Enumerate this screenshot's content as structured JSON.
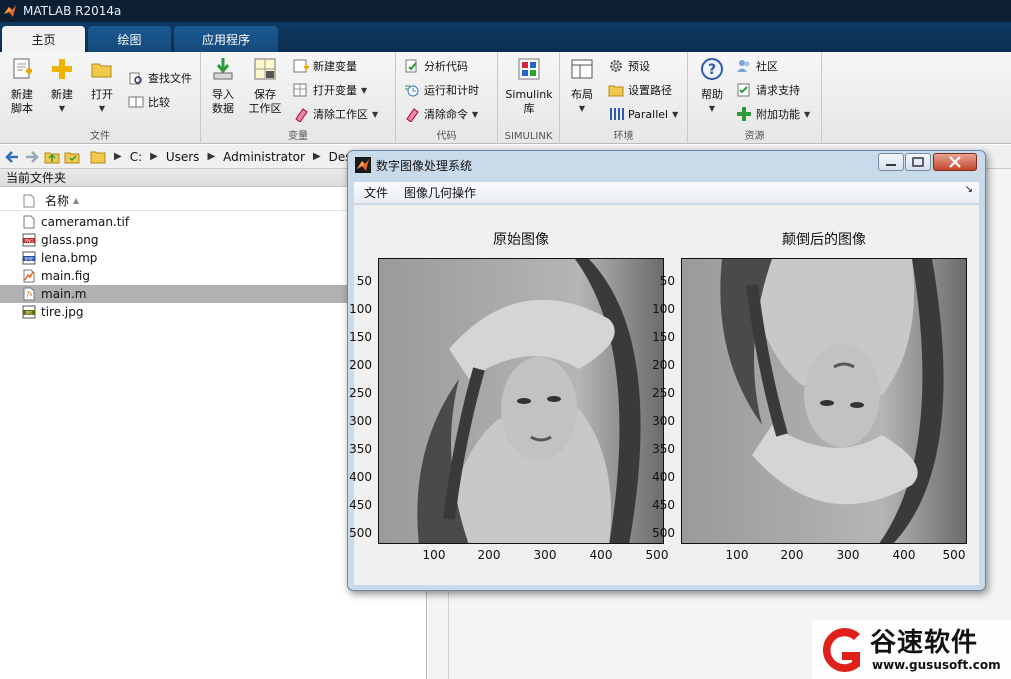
{
  "window": {
    "title": "MATLAB R2014a"
  },
  "tabs": [
    {
      "label": "主页",
      "active": true
    },
    {
      "label": "绘图",
      "active": false
    },
    {
      "label": "应用程序",
      "active": false
    }
  ],
  "toolstrip": {
    "file_group": {
      "label": "文件",
      "new_script": "新建\n脚本",
      "new": "新建",
      "open": "打开",
      "find_files": "查找文件",
      "compare": "比较"
    },
    "variable_group": {
      "label": "变量",
      "import_data": "导入\n数据",
      "save_workspace": "保存\n工作区",
      "new_variable": "新建变量",
      "open_variable": "打开变量",
      "clear_workspace": "清除工作区"
    },
    "code_group": {
      "label": "代码",
      "analyze_code": "分析代码",
      "run_and_time": "运行和计时",
      "clear_commands": "清除命令"
    },
    "simulink_group": {
      "label": "SIMULINK",
      "library": "Simulink\n库"
    },
    "environment_group": {
      "label": "环境",
      "layout": "布局",
      "preferences": "预设",
      "set_path": "设置路径",
      "parallel": "Parallel"
    },
    "resources_group": {
      "label": "资源",
      "help": "帮助",
      "community": "社区",
      "request_support": "请求支持",
      "add_ons": "附加功能"
    }
  },
  "address": {
    "path": [
      "C:",
      "Users",
      "Administrator",
      "Des"
    ]
  },
  "current_folder": {
    "title": "当前文件夹",
    "column_name": "名称",
    "files": [
      {
        "name": "cameraman.tif",
        "icon": "tif-file-icon",
        "selected": false
      },
      {
        "name": "glass.png",
        "icon": "png-file-icon",
        "selected": false
      },
      {
        "name": "lena.bmp",
        "icon": "bmp-file-icon",
        "selected": false
      },
      {
        "name": "main.fig",
        "icon": "fig-file-icon",
        "selected": false
      },
      {
        "name": "main.m",
        "icon": "m-file-icon",
        "selected": true
      },
      {
        "name": "tire.jpg",
        "icon": "jpg-file-icon",
        "selected": false
      }
    ]
  },
  "figure": {
    "title": "数字图像处理系统",
    "menu": [
      "文件",
      "图像几何操作"
    ],
    "dock_glyph": "↘",
    "left_axes": {
      "title": "原始图像",
      "yticks": [
        "50",
        "100",
        "150",
        "200",
        "250",
        "300",
        "350",
        "400",
        "450",
        "500"
      ],
      "xticks": [
        "100",
        "200",
        "300",
        "400",
        "500"
      ]
    },
    "right_axes": {
      "title": "颠倒后的图像",
      "yticks": [
        "50",
        "100",
        "150",
        "200",
        "250",
        "300",
        "350",
        "400",
        "450",
        "500"
      ],
      "xticks": [
        "100",
        "200",
        "300",
        "400",
        "500"
      ]
    }
  },
  "watermark": {
    "brand": "谷速软件",
    "url": "www.gususoft.com"
  },
  "colors": {
    "title_bar": "#0f1f33",
    "tab_bar": "#0e3a63",
    "selection": "#b1b1b1",
    "figure_frame": "#c9daea",
    "watermark_red": "#e0201b"
  }
}
